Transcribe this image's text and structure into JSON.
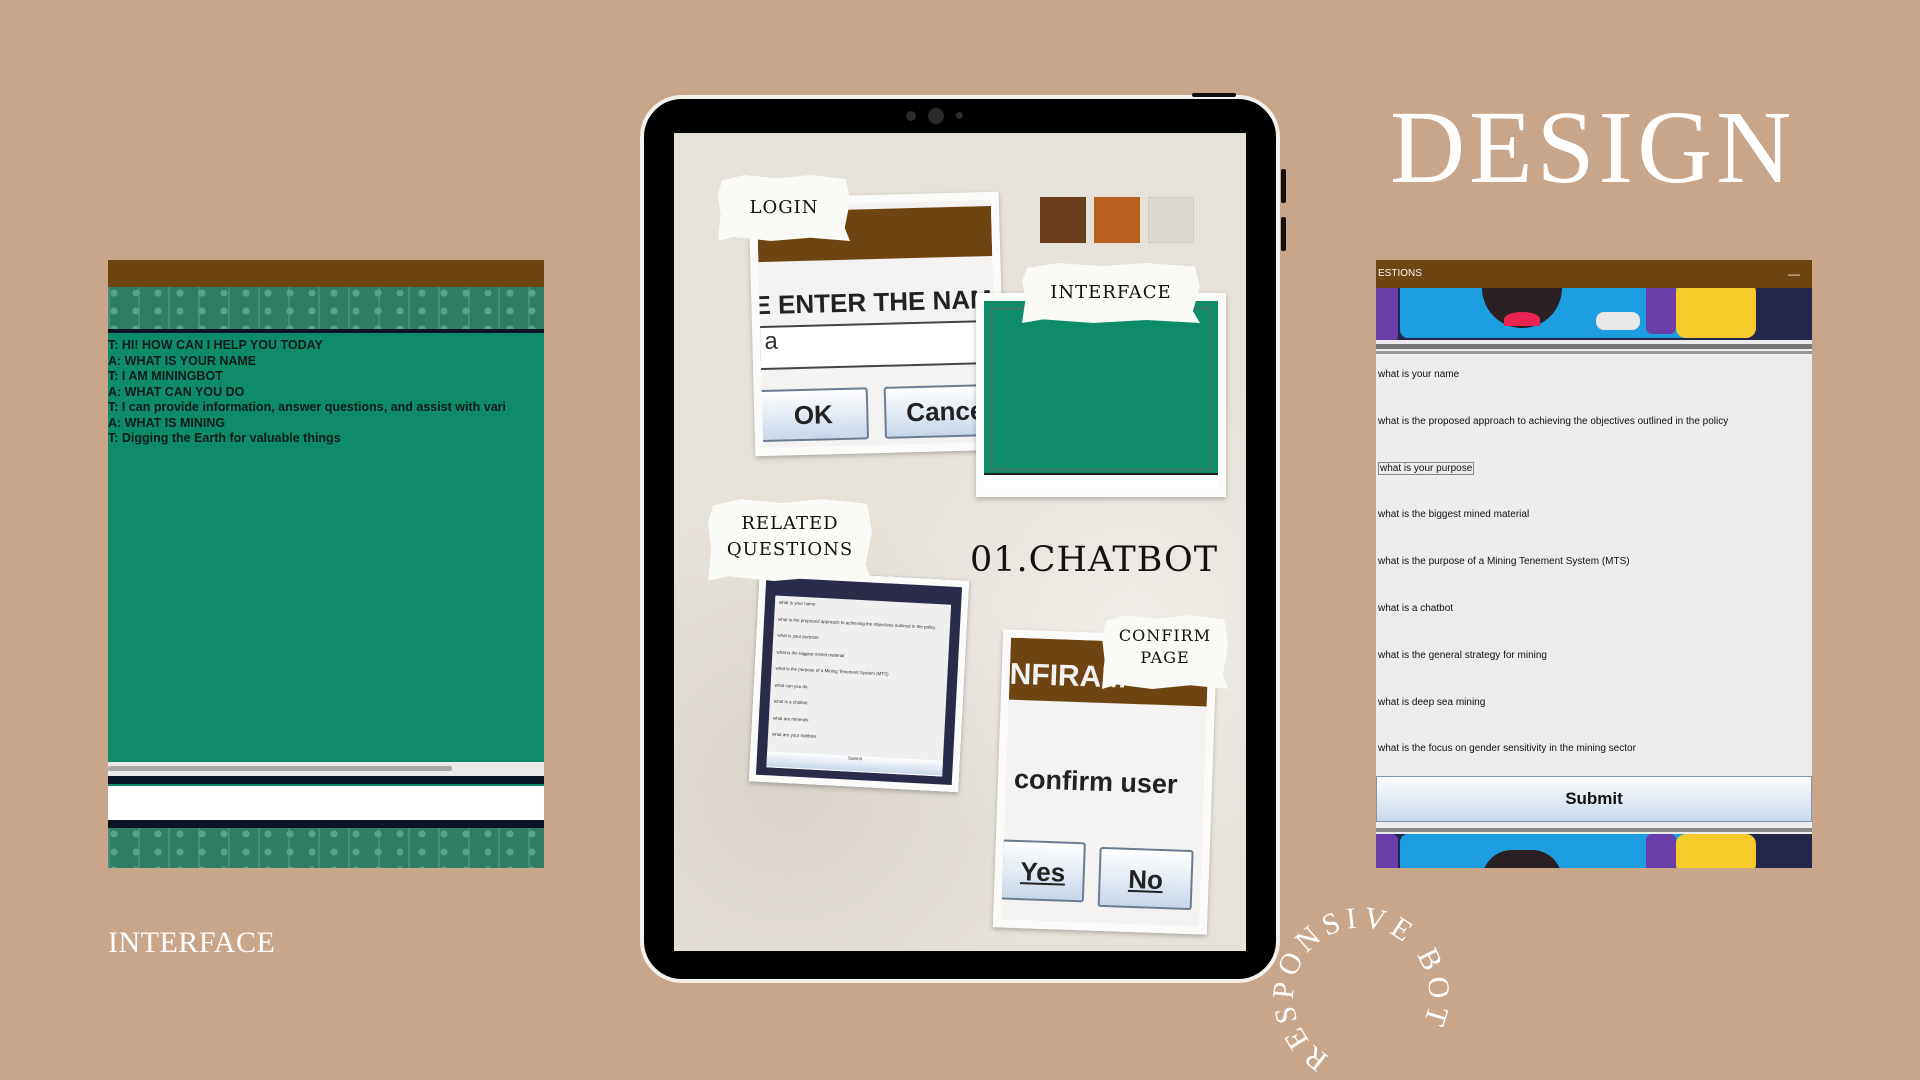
{
  "left_panel": {
    "chat": [
      "T: HI! HOW CAN I HELP YOU TODAY",
      "A: WHAT IS YOUR NAME",
      "T: I AM MININGBOT",
      "A: WHAT CAN YOU DO",
      "T: I can provide information, answer questions, and assist with vari",
      "A: WHAT IS MINING",
      "T: Digging the Earth for valuable things"
    ],
    "input_value": "",
    "caption": "INTERFACE"
  },
  "tablet": {
    "login_tag": "LOGIN",
    "login_prompt": "E ENTER THE NAM",
    "login_input_value": "a",
    "ok_label": "OK",
    "cancel_label": "Cance",
    "interface_tag": "INTERFACE",
    "related_tag": "RELATED QUESTIONS",
    "chatbot_title": "01.CHATBOT",
    "confirm_tag": "CONFIRM PAGE",
    "confirm_header": "NFIRAM",
    "confirm_text": "confirm user",
    "yes_label": "Yes",
    "no_label": "No",
    "swatches": [
      "#6b3f1e",
      "#b8601e",
      "#dcd8d1"
    ],
    "mini_list": [
      "what is your name",
      "what is the proposed approach to achieving the objectives outlined in the policy",
      "what is your purpose",
      "what is the biggest mined material",
      "what is the purpose of a Mining Tenement System (MTS)",
      "what can you do",
      "what is a chatbot",
      "what are minerals",
      "what are your hobbies"
    ],
    "mini_submit": "Submit"
  },
  "design_title": "DESIGN",
  "right_panel": {
    "title": "ESTIONS",
    "minimize": "—",
    "questions": [
      "what is your name",
      "what is the proposed approach to achieving the objectives outlined in the policy",
      "what is your purpose",
      "what is the biggest mined material",
      "what is the purpose of a Mining Tenement System (MTS)",
      "what is a chatbot",
      "what is the general strategy for mining",
      "what is deep sea mining",
      "what is the focus on gender sensitivity in the mining sector"
    ],
    "submit_label": "Submit"
  },
  "circular_text": "RESPONSIVE BOT",
  "colors": {
    "background": "#c9a58a",
    "brown_bar": "#6e4512",
    "chat_green": "#0e8c6a"
  }
}
